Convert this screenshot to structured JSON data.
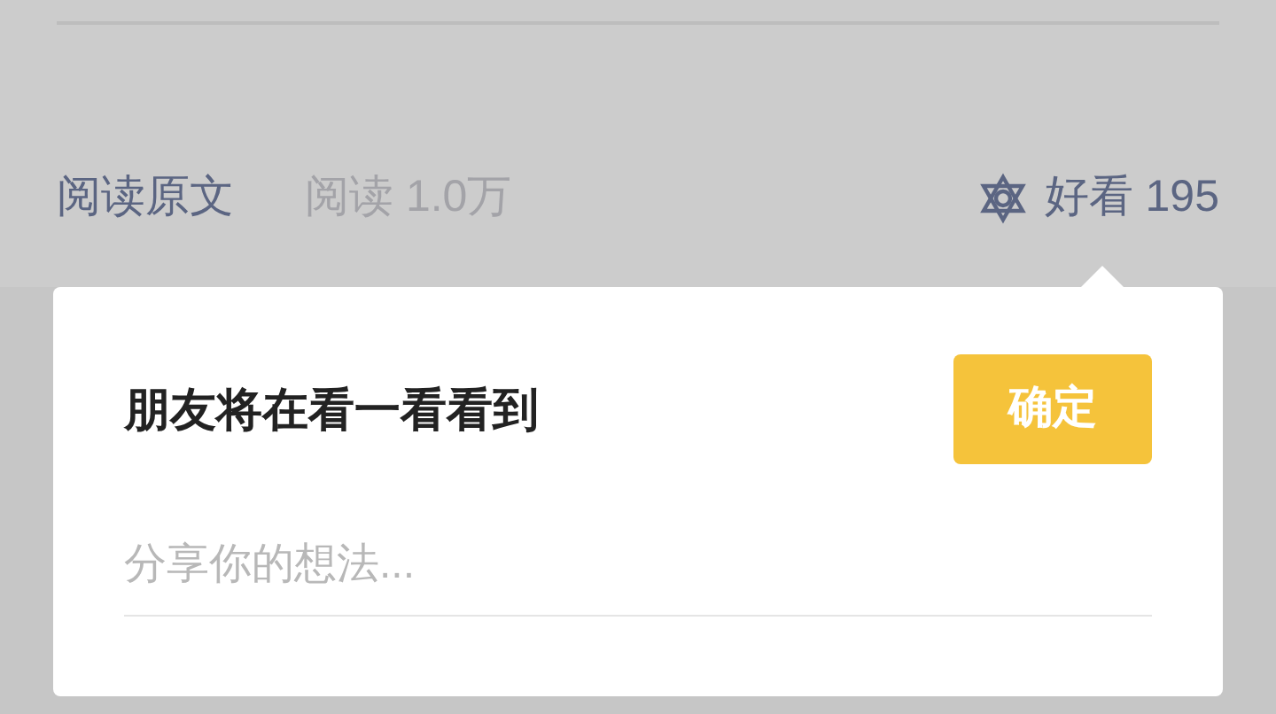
{
  "article_footer": {
    "read_original": "阅读原文",
    "read_count": "阅读 1.0万",
    "like": {
      "label": "好看 195"
    }
  },
  "popup": {
    "title": "朋友将在看一看看到",
    "confirm_button": "确定",
    "comment": {
      "placeholder": "分享你的想法..."
    }
  }
}
